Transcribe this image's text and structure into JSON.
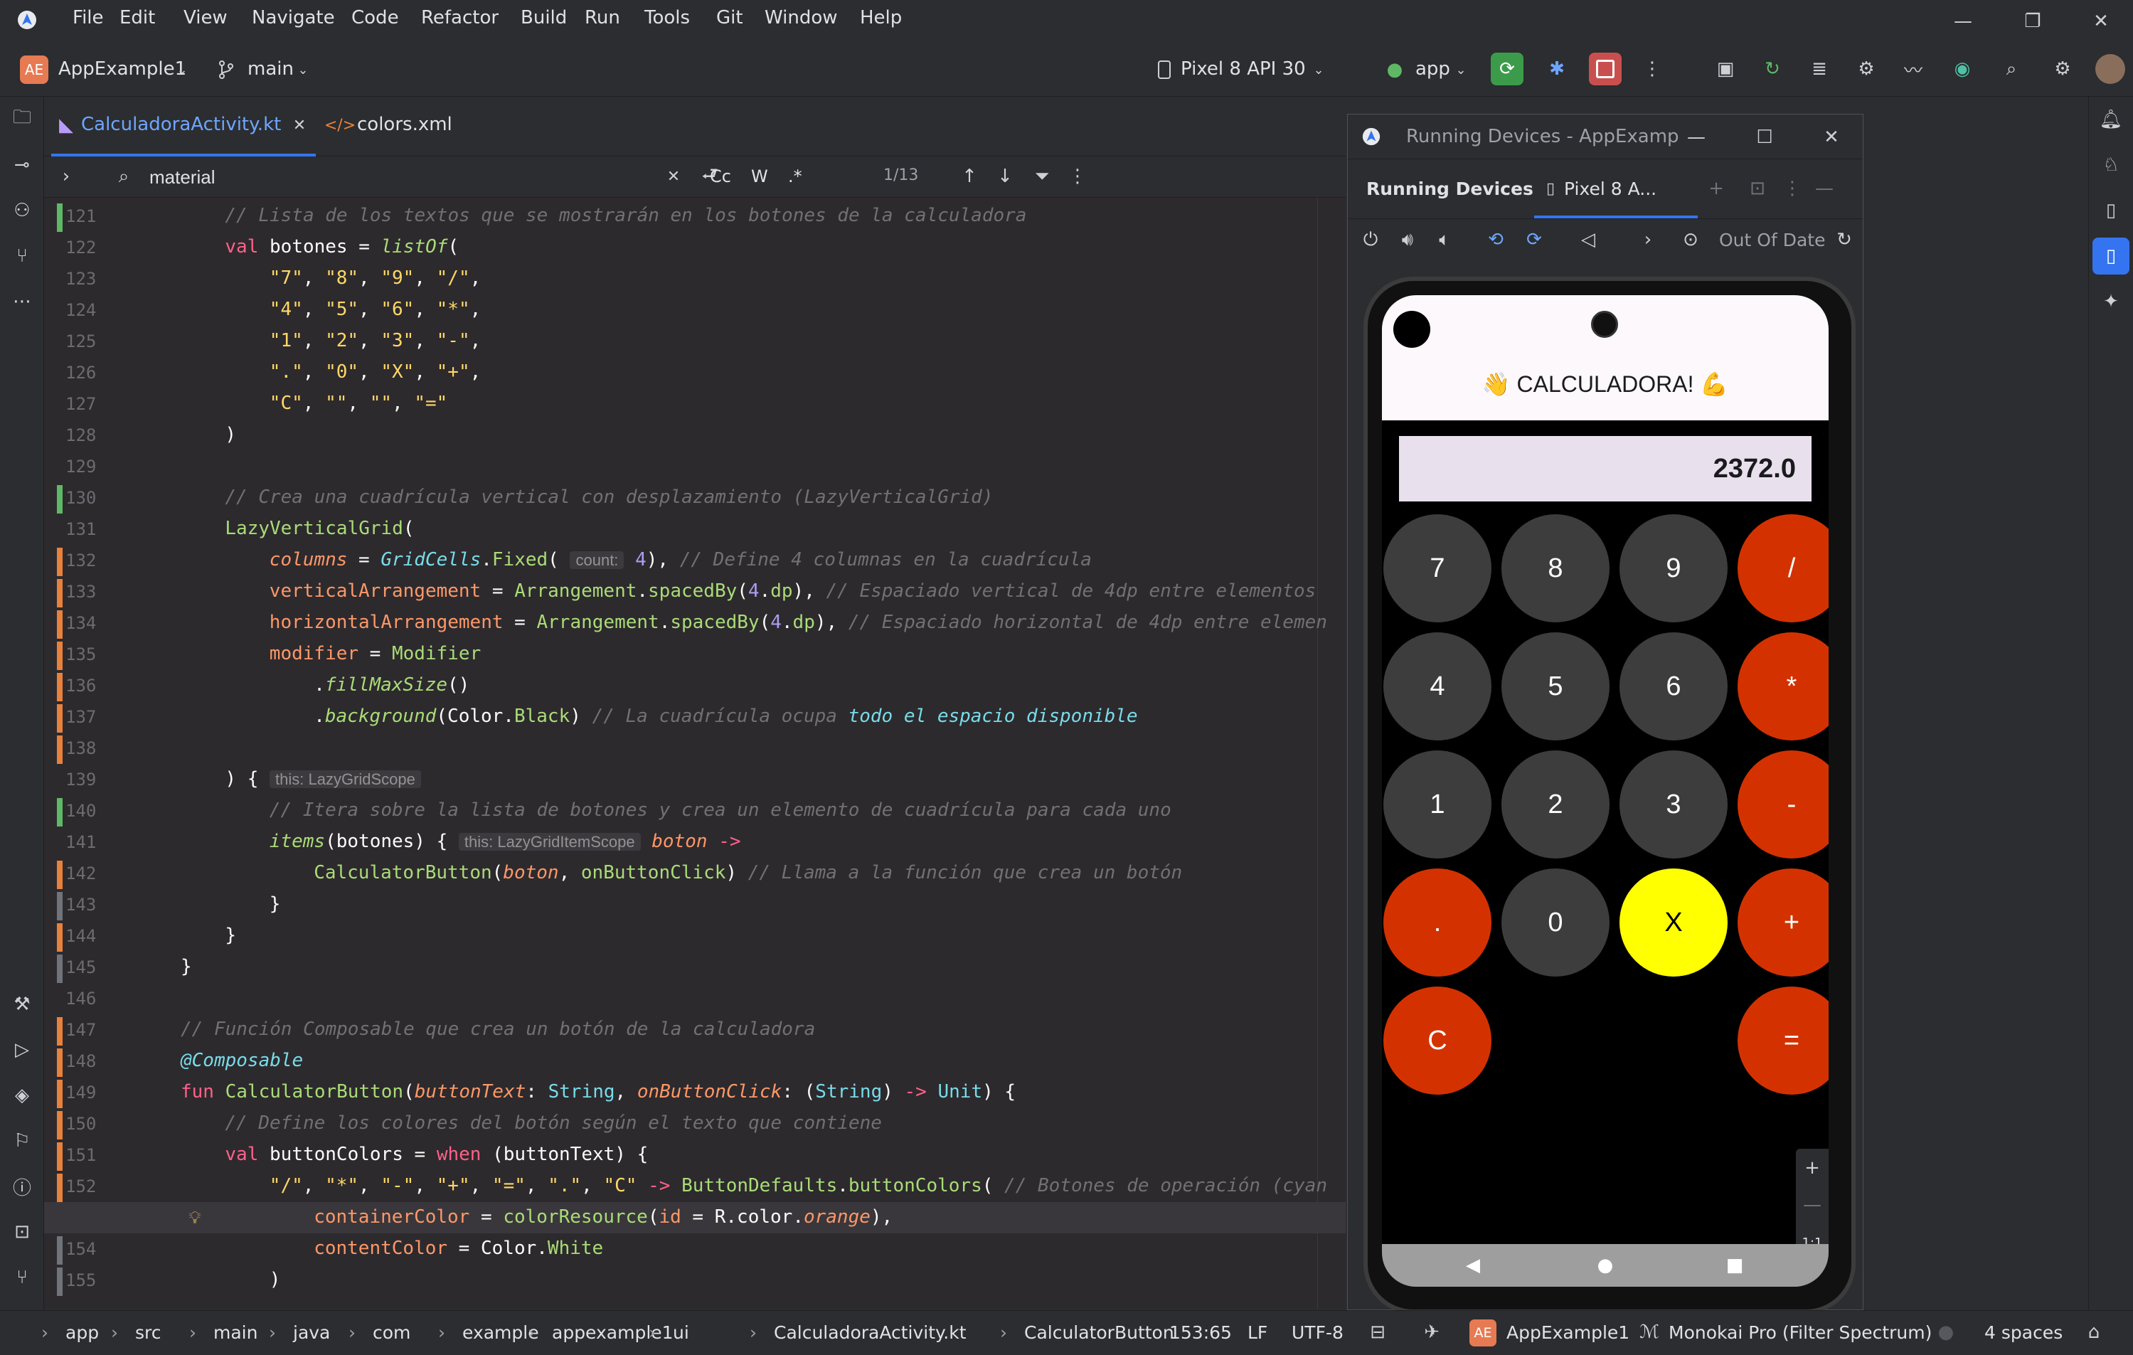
{
  "menu": [
    "File",
    "Edit",
    "View",
    "Navigate",
    "Code",
    "Refactor",
    "Build",
    "Run",
    "Tools",
    "Git",
    "Window",
    "Help"
  ],
  "project": {
    "badge": "AE",
    "name": "AppExample1",
    "branch": "main"
  },
  "device_selector": "Pixel 8 API 30",
  "run_config": "app",
  "tabs": [
    {
      "label": "CalculadoraActivity.kt",
      "active": true
    },
    {
      "label": "colors.xml",
      "active": false
    }
  ],
  "search": {
    "query": "material",
    "match": "1/13",
    "opt_case": "Cc",
    "opt_word": "W",
    "opt_regex": ".*"
  },
  "code_lines": [
    {
      "n": "121",
      "html": "<span class='c-com'>// Lista de los textos que se mostrarán en los botones de la calculadora</span>",
      "indent": 4,
      "mark": "#5fb865"
    },
    {
      "n": "122",
      "html": "<span class='c-kw'>val</span> botones = <span class='c-fn' style='font-style:italic'>listOf</span>(",
      "indent": 4
    },
    {
      "n": "123",
      "html": "<span class='c-str'>\"7\"</span>, <span class='c-str'>\"8\"</span>, <span class='c-str'>\"9\"</span>, <span class='c-str'>\"/\"</span>,",
      "indent": 8
    },
    {
      "n": "124",
      "html": "<span class='c-str'>\"4\"</span>, <span class='c-str'>\"5\"</span>, <span class='c-str'>\"6\"</span>, <span class='c-str'>\"*\"</span>,",
      "indent": 8
    },
    {
      "n": "125",
      "html": "<span class='c-str'>\"1\"</span>, <span class='c-str'>\"2\"</span>, <span class='c-str'>\"3\"</span>, <span class='c-str'>\"-\"</span>,",
      "indent": 8
    },
    {
      "n": "126",
      "html": "<span class='c-str'>\".\"</span>, <span class='c-str'>\"0\"</span>, <span class='c-str'>\"X\"</span>, <span class='c-str'>\"+\"</span>,",
      "indent": 8
    },
    {
      "n": "127",
      "html": "<span class='c-str'>\"C\"</span>, <span class='c-str'>\"\"</span>, <span class='c-str'>\"\"</span>, <span class='c-str'>\"=\"</span>",
      "indent": 8
    },
    {
      "n": "128",
      "html": ")",
      "indent": 4
    },
    {
      "n": "129",
      "html": "",
      "indent": 0
    },
    {
      "n": "130",
      "html": "<span class='c-com'>// Crea una cuadrícula vertical con desplazamiento (LazyVerticalGrid)</span>",
      "indent": 4,
      "mark": "#5fb865"
    },
    {
      "n": "131",
      "html": "<span class='c-fn'>LazyVerticalGrid</span>(",
      "indent": 4
    },
    {
      "n": "132",
      "html": "<span class='c-par'>columns</span> = <span class='c-ty'>GridCells</span>.<span class='c-fn'>Fixed</span>( <span class='hint'>count:</span> <span class='c-num'>4</span>), <span class='c-com'>// Define 4 columnas en la cuadrícula</span>",
      "indent": 8,
      "mark": "#e8813b"
    },
    {
      "n": "133",
      "html": "<span class='c-par' style='font-style:normal'>verticalArrangement</span> = <span class='c-fn'>Arrangement</span>.<span class='c-fn'>spacedBy</span>(<span class='c-num'>4</span>.<span class='c-fn'>dp</span>), <span class='c-com'>// Espaciado vertical de 4dp entre elementos</span>",
      "indent": 8,
      "mark": "#e8813b"
    },
    {
      "n": "134",
      "html": "<span class='c-par' style='font-style:normal'>horizontalArrangement</span> = <span class='c-fn'>Arrangement</span>.<span class='c-fn'>spacedBy</span>(<span class='c-num'>4</span>.<span class='c-fn'>dp</span>), <span class='c-com'>// Espaciado horizontal de 4dp entre elemen</span>",
      "indent": 8,
      "mark": "#e8813b"
    },
    {
      "n": "135",
      "html": "<span class='c-par' style='font-style:normal'>modifier</span> = <span class='c-fn'>Modifier</span>",
      "indent": 8,
      "mark": "#e8813b"
    },
    {
      "n": "136",
      "html": ".<span class='c-fn' style='font-style:italic'>fillMaxSize</span>()",
      "indent": 12,
      "mark": "#e8813b"
    },
    {
      "n": "137",
      "html": ".<span class='c-fn' style='font-style:italic'>background</span>(Color.<span class='c-fn'>Black</span>) <span class='c-com'>// La cuadrícula ocupa </span><span class='c-ty'>todo el espacio disponible</span>",
      "indent": 12,
      "mark": "#e8813b"
    },
    {
      "n": "138",
      "html": "",
      "indent": 0,
      "mark": "#e8813b"
    },
    {
      "n": "139",
      "html": ") { <span class='hint'>this: LazyGridScope</span>",
      "indent": 4
    },
    {
      "n": "140",
      "html": "<span class='c-com'>// Itera sobre la lista de botones y crea un elemento de cuadrícula para cada uno</span>",
      "indent": 8,
      "mark": "#5fb865"
    },
    {
      "n": "141",
      "html": "<span class='c-fn' style='font-style:italic'>items</span>(botones) { <span class='hint'>this: LazyGridItemScope</span> <span class='c-par'>boton</span> <span class='c-kw'>-&gt;</span>",
      "indent": 8
    },
    {
      "n": "142",
      "html": "<span class='c-fn'>CalculatorButton</span>(<span class='c-par'>boton</span>, <span class='c-fn'>onButtonClick</span>) <span class='c-com'>// Llama a la función que crea un botón</span>",
      "indent": 12,
      "mark": "#e8813b"
    },
    {
      "n": "143",
      "html": "}",
      "indent": 8,
      "mark": "#6f737a"
    },
    {
      "n": "144",
      "html": "}",
      "indent": 4,
      "mark": "#e8813b"
    },
    {
      "n": "145",
      "html": "}",
      "indent": 0,
      "mark": "#6f737a"
    },
    {
      "n": "146",
      "html": "",
      "indent": 0
    },
    {
      "n": "147",
      "html": "<span class='c-com'>// Función Composable que crea un botón de la calculadora</span>",
      "indent": 0,
      "mark": "#e8813b"
    },
    {
      "n": "148",
      "html": "<span class='c-ty'>@Composable</span>",
      "indent": 0,
      "mark": "#e8813b"
    },
    {
      "n": "149",
      "html": "<span class='c-kw'>fun</span> <span class='c-fn'>CalculatorButton</span>(<span class='c-par'>buttonText</span>: <span class='c-ty' style='font-style:normal'>String</span>, <span class='c-par'>onButtonClick</span>: (<span class='c-ty' style='font-style:normal'>String</span>) <span class='c-kw'>-&gt;</span> <span class='c-ty' style='font-style:normal'>Unit</span>) {",
      "indent": 0,
      "mark": "#e8813b"
    },
    {
      "n": "150",
      "html": "<span class='c-com'>// Define los colores del botón según el texto que contiene</span>",
      "indent": 4,
      "mark": "#e8813b"
    },
    {
      "n": "151",
      "html": "<span class='c-kw'>val</span> buttonColors = <span class='c-kw'>when</span> (buttonText) {",
      "indent": 4,
      "mark": "#e8813b"
    },
    {
      "n": "152",
      "html": "<span class='c-str'>\"/\"</span>, <span class='c-str'>\"*\"</span>, <span class='c-str'>\"-\"</span>, <span class='c-str'>\"+\"</span>, <span class='c-str'>\"=\"</span>, <span class='c-str'>\".\"</span>, <span class='c-str'>\"C\"</span> <span class='c-kw'>-&gt;</span> <span class='c-fn'>ButtonDefaults</span>.<span class='c-fn'>buttonColors</span>( <span class='c-com'>// Botones de operación (cyan</span>",
      "indent": 8,
      "mark": "#e8813b"
    },
    {
      "n": "153",
      "html": "<span class='c-par' style='font-style:normal'>containerColor</span> = <span class='c-fn'>colorResource</span>(<span class='c-par' style='font-style:normal'>id</span> = R.color.<span class='c-par'>orange</span>),",
      "indent": 12,
      "mark": "#e8813b",
      "current": true
    },
    {
      "n": "154",
      "html": "<span class='c-par' style='font-style:normal'>contentColor</span> = Color.<span class='c-fn'>White</span>",
      "indent": 12,
      "mark": "#6f737a"
    },
    {
      "n": "155",
      "html": ")",
      "indent": 8,
      "mark": "#6f737a"
    }
  ],
  "running_devices": {
    "window_title": "Running Devices - AppExamp",
    "tab_label": "Running Devices",
    "device_tab": "Pixel 8 A...",
    "status": "Out Of Date",
    "zoom_ratio": "1:1"
  },
  "app": {
    "title": "👋 CALCULADORA! 💪",
    "display": "2372.0",
    "buttons": [
      {
        "label": "7",
        "kind": "num"
      },
      {
        "label": "8",
        "kind": "num"
      },
      {
        "label": "9",
        "kind": "num"
      },
      {
        "label": "/",
        "kind": "op"
      },
      {
        "label": "4",
        "kind": "num"
      },
      {
        "label": "5",
        "kind": "num"
      },
      {
        "label": "6",
        "kind": "num"
      },
      {
        "label": "*",
        "kind": "op"
      },
      {
        "label": "1",
        "kind": "num"
      },
      {
        "label": "2",
        "kind": "num"
      },
      {
        "label": "3",
        "kind": "num"
      },
      {
        "label": "-",
        "kind": "op"
      },
      {
        "label": ".",
        "kind": "op"
      },
      {
        "label": "0",
        "kind": "num"
      },
      {
        "label": "X",
        "kind": "special"
      },
      {
        "label": "+",
        "kind": "op"
      },
      {
        "label": "C",
        "kind": "op"
      },
      {
        "label": "",
        "kind": "empty"
      },
      {
        "label": "",
        "kind": "empty"
      },
      {
        "label": "=",
        "kind": "op"
      }
    ]
  },
  "colors": {
    "op": "#d33200",
    "num": "#3d3d3d",
    "special": "#ffff00",
    "accent": "#3574f0"
  },
  "breadcrumb": [
    "app",
    "src",
    "main",
    "java",
    "com",
    "example",
    "appexample1",
    "ui",
    "CalculadoraActivity.kt",
    "CalculatorButton"
  ],
  "status": {
    "position": "153:65",
    "line_sep": "LF",
    "encoding": "UTF-8",
    "project_badge": "AE",
    "project": "AppExample1",
    "theme": "Monokai Pro (Filter Spectrum)",
    "indent": "4 spaces"
  }
}
